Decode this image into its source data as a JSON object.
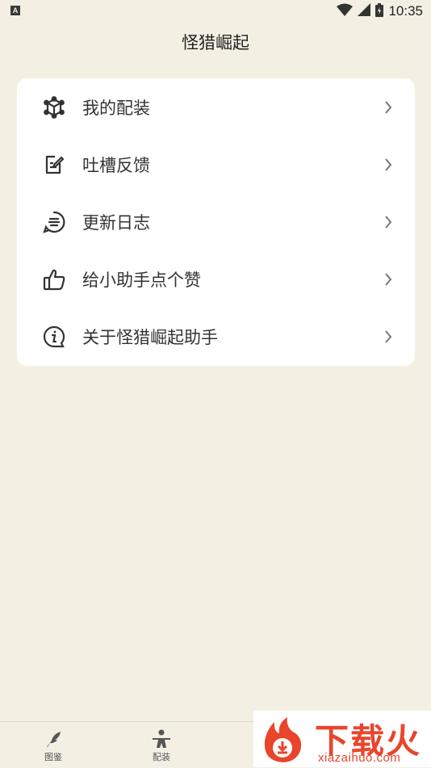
{
  "status_bar": {
    "time": "10:35",
    "badge": "A"
  },
  "header": {
    "title": "怪猎崛起"
  },
  "menu": {
    "items": [
      {
        "label": "我的配装",
        "icon": "gear-cube-icon"
      },
      {
        "label": "吐槽反馈",
        "icon": "edit-note-icon"
      },
      {
        "label": "更新日志",
        "icon": "message-list-icon"
      },
      {
        "label": "给小助手点个赞",
        "icon": "thumbs-up-icon"
      },
      {
        "label": "关于怪猎崛起助手",
        "icon": "info-bubble-icon"
      }
    ]
  },
  "tabbar": {
    "tabs": [
      {
        "label": "图鉴",
        "icon": "feather-icon"
      },
      {
        "label": "配装",
        "icon": "warrior-icon"
      }
    ]
  },
  "watermark": {
    "text": "下载火",
    "url": "xiazaihuo.com"
  },
  "colors": {
    "background": "#f3efe3",
    "card": "#ffffff",
    "watermark_red": "#e8452c"
  }
}
